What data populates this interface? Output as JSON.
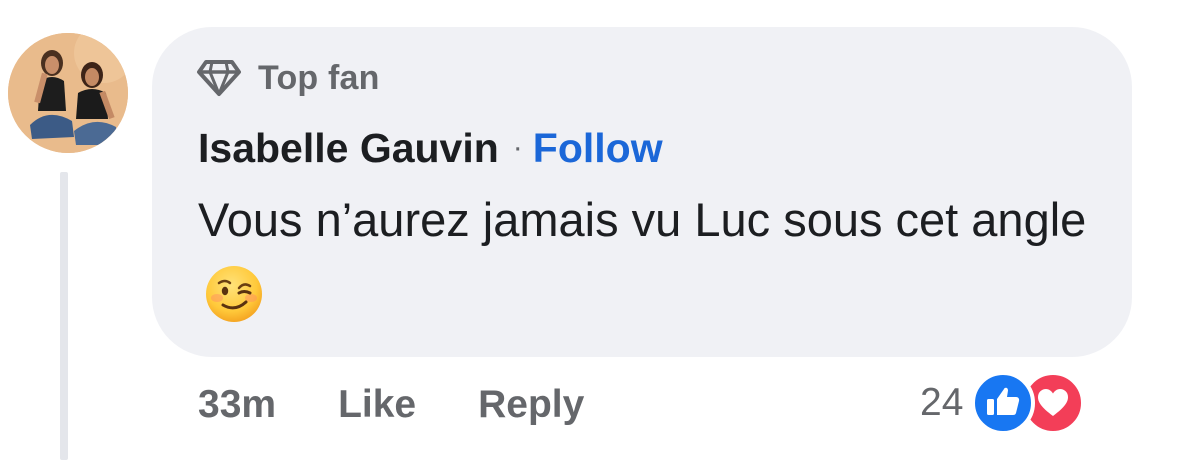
{
  "comment": {
    "badge": {
      "icon": "diamond-icon",
      "label": "Top fan"
    },
    "author": {
      "name": "Isabelle Gauvin",
      "separator": "·",
      "follow_label": "Follow"
    },
    "text": "Vous n’aurez jamais vu Luc sous cet angle",
    "emoji": "winking-face-emoji",
    "actions": {
      "time": "33m",
      "like_label": "Like",
      "reply_label": "Reply"
    },
    "reactions": {
      "count": "24",
      "types": [
        "like-reaction-icon",
        "love-reaction-icon"
      ]
    }
  },
  "colors": {
    "bubble_bg": "#f0f1f5",
    "link_blue": "#1b67d8",
    "secondary_text": "#65676b",
    "primary_text": "#1c1e21",
    "like_blue": "#1877f2",
    "love_red": "#f33e58"
  }
}
